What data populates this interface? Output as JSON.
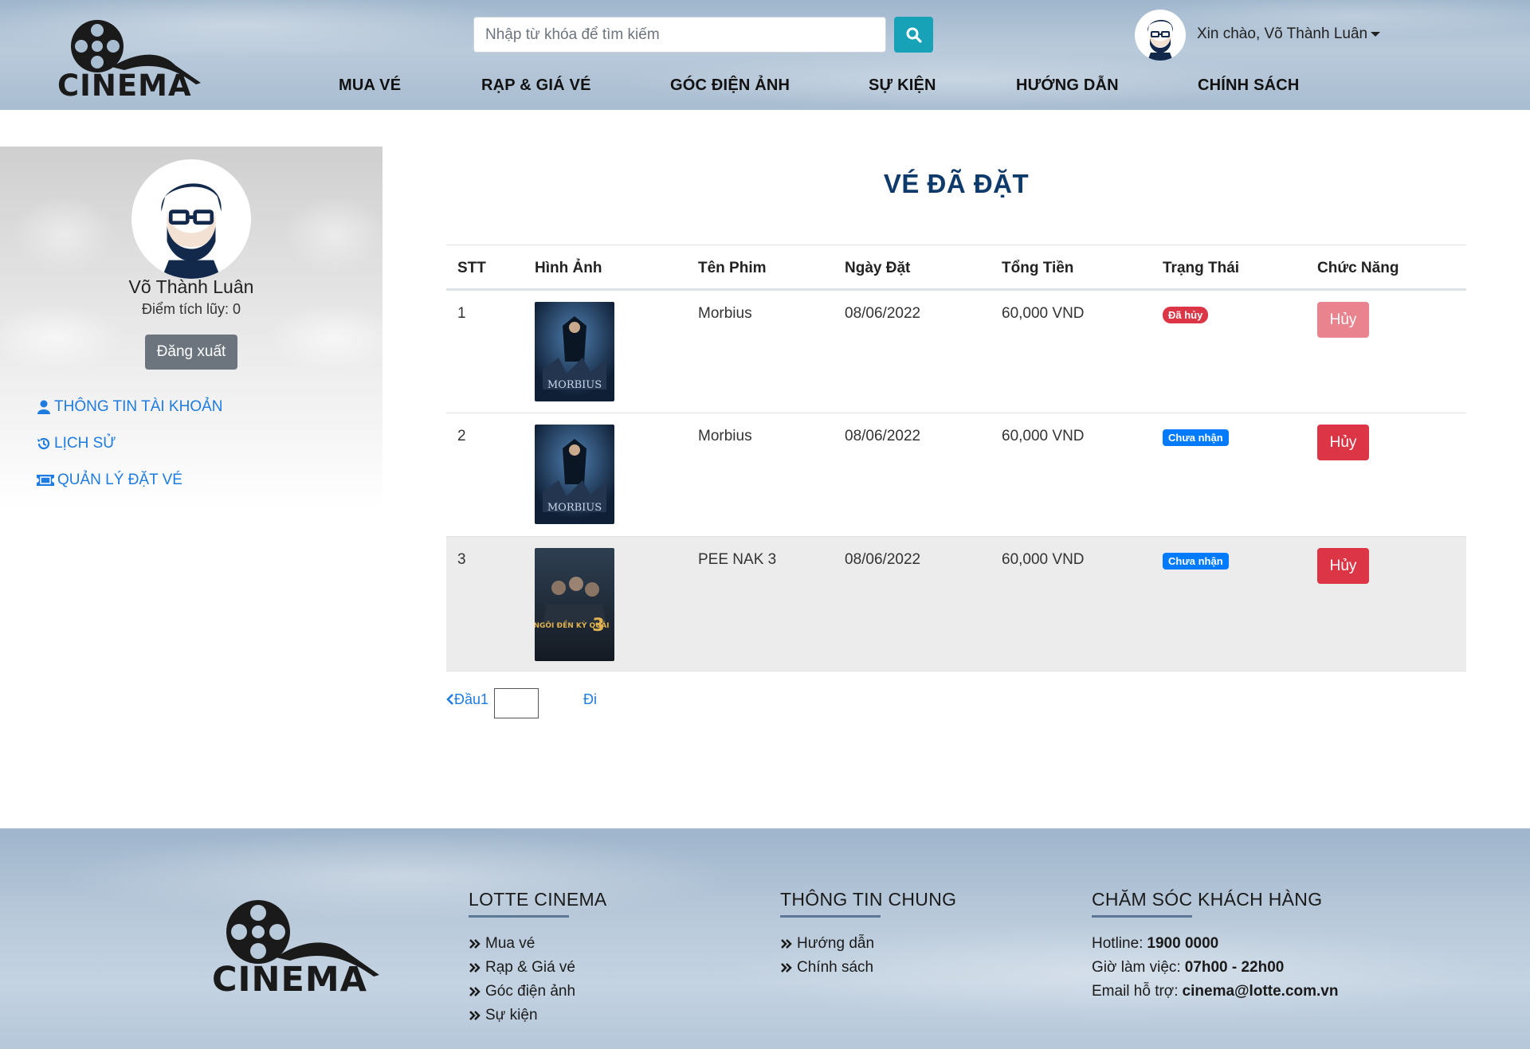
{
  "header": {
    "search_placeholder": "Nhập từ khóa để tìm kiếm",
    "greeting": "Xin chào, Võ Thành Luân",
    "nav": [
      "MUA VÉ",
      "RẠP & GIÁ VÉ",
      "GÓC ĐIỆN ẢNH",
      "SỰ KIỆN",
      "HƯỚNG DẪN",
      "CHÍNH SÁCH"
    ]
  },
  "sidebar": {
    "name": "Võ Thành Luân",
    "points": "Điểm tích lũy: 0",
    "logout": "Đăng xuất",
    "links": [
      "THÔNG TIN TÀI KHOẢN",
      "LỊCH SỬ",
      "QUẢN LÝ ĐẶT VÉ"
    ]
  },
  "main": {
    "title": "VÉ ĐÃ ĐẶT",
    "columns": [
      "STT",
      "Hình Ảnh",
      "Tên Phim",
      "Ngày Đặt",
      "Tổng Tiền",
      "Trạng Thái",
      "Chức Năng"
    ],
    "rows": [
      {
        "stt": "1",
        "movie": "Morbius",
        "date": "08/06/2022",
        "total": "60,000 VND",
        "status": "Đã hủy",
        "action": "Hủy"
      },
      {
        "stt": "2",
        "movie": "Morbius",
        "date": "08/06/2022",
        "total": "60,000 VND",
        "status": "Chưa nhận",
        "action": "Hủy"
      },
      {
        "stt": "3",
        "movie": "PEE NAK 3",
        "date": "08/06/2022",
        "total": "60,000 VND",
        "status": "Chưa nhận",
        "action": "Hủy"
      }
    ],
    "poster_text": {
      "morbius": "MORBIUS",
      "peenak": "NGÔI ĐỀN KỲ QUÁI"
    },
    "pager": {
      "first": "Đầu",
      "current": "1",
      "go": "Đi"
    }
  },
  "footer": {
    "logo_text": "CINEMA",
    "col1": {
      "title": "LOTTE CINEMA",
      "items": [
        "Mua vé",
        "Rạp & Giá vé",
        "Góc điện ảnh",
        "Sự kiện"
      ]
    },
    "col2": {
      "title": "THÔNG TIN CHUNG",
      "items": [
        "Hướng dẫn",
        "Chính sách"
      ]
    },
    "col3": {
      "title": "CHĂM SÓC KHÁCH HÀNG",
      "hotline_label": "Hotline:",
      "hotline": "1900 0000",
      "hours_label": "Giờ làm việc:",
      "hours": "07h00 - 22h00",
      "email_label": "Email hỗ trợ:",
      "email": "cinema@lotte.com.vn"
    }
  },
  "brand": {
    "logo_text": "CINEMA"
  },
  "colors": {
    "accent": "#17a2b8",
    "title": "#0e3a6b",
    "link": "#1e7be0",
    "danger": "#dc3545",
    "primary": "#007bff"
  }
}
